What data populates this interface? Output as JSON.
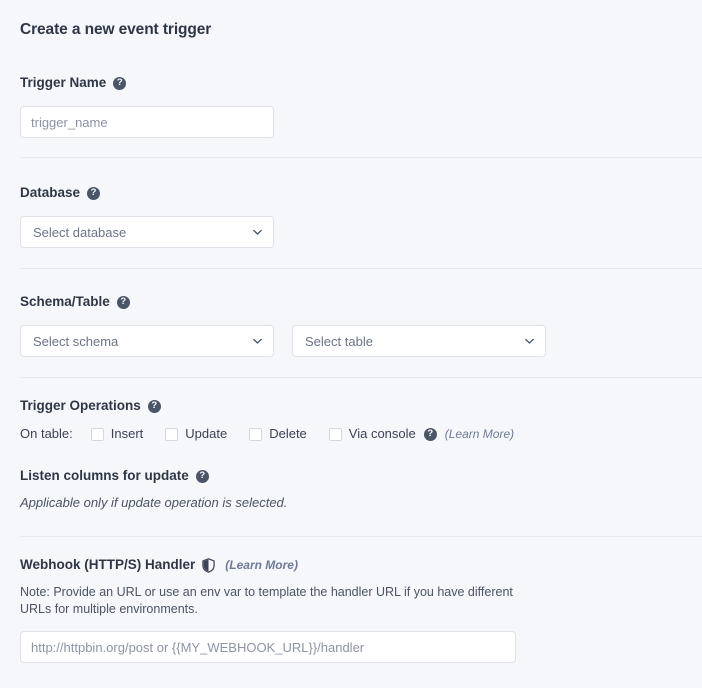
{
  "page": {
    "title": "Create a new event trigger",
    "background_color": "#f5f7fa",
    "text_color": "#3b4256",
    "accent_link_color": "#6e7b96"
  },
  "trigger_name": {
    "label": "Trigger Name",
    "help_icon": "help-circle-icon",
    "input_placeholder": "trigger_name",
    "input_value": ""
  },
  "database": {
    "label": "Database",
    "help_icon": "help-circle-icon",
    "select_value": "Select database",
    "chevron_icon": "chevron-down-icon"
  },
  "schema_table": {
    "label": "Schema/Table",
    "help_icon": "help-circle-icon",
    "schema_select_value": "Select schema",
    "table_select_value": "Select table",
    "chevron_icon": "chevron-down-icon"
  },
  "trigger_operations": {
    "label": "Trigger Operations",
    "help_icon": "help-circle-icon",
    "on_table_label": "On table:",
    "learn_more": "(Learn More)",
    "via_console_help_icon": "help-circle-icon",
    "checkboxes": [
      {
        "label": "Insert",
        "checked": false
      },
      {
        "label": "Update",
        "checked": false
      },
      {
        "label": "Delete",
        "checked": false
      },
      {
        "label": "Via console",
        "checked": false
      }
    ]
  },
  "listen_columns": {
    "label": "Listen columns for update",
    "help_icon": "help-circle-icon",
    "hint": "Applicable only if update operation is selected."
  },
  "webhook": {
    "label": "Webhook (HTTP/S) Handler",
    "shield_icon": "shield-icon",
    "learn_more": "(Learn More)",
    "note": "Note: Provide an URL or use an env var to template the handler URL if you have different URLs for multiple environments.",
    "input_placeholder": "http://httpbin.org/post or {{MY_WEBHOOK_URL}}/handler",
    "input_value": ""
  }
}
